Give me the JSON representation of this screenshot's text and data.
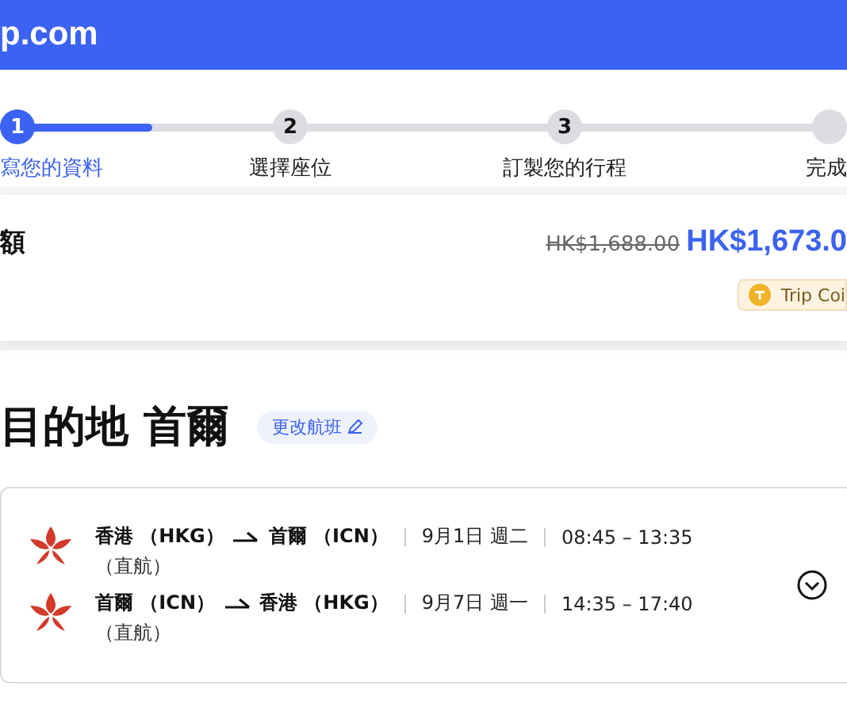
{
  "header": {
    "logo_text": "p.com"
  },
  "steps": [
    {
      "number": "1",
      "label": "寫您的資料",
      "selected": true
    },
    {
      "number": "2",
      "label": "選擇座位",
      "selected": false
    },
    {
      "number": "3",
      "label": "訂製您的行程",
      "selected": false
    },
    {
      "label": "完成",
      "selected": false
    }
  ],
  "progress": {
    "level": 0.18
  },
  "price": {
    "title": "額",
    "original": "HK$1,688.00",
    "current": "HK$1,673.0",
    "coin_badge": "Trip Coi"
  },
  "destination": {
    "heading": "目的地 首爾",
    "change_button": "更改航班"
  },
  "flights": [
    {
      "from": "香港 （HKG）",
      "to": "首爾 （ICN）",
      "date": "9月1日 週二",
      "time": "08:45 – 13:35",
      "note": "（直航）"
    },
    {
      "from": "首爾 （ICN）",
      "to": "香港 （HKG）",
      "date": "9月7日 週一",
      "time": "14:35 – 17:40",
      "note": "（直航）"
    }
  ]
}
